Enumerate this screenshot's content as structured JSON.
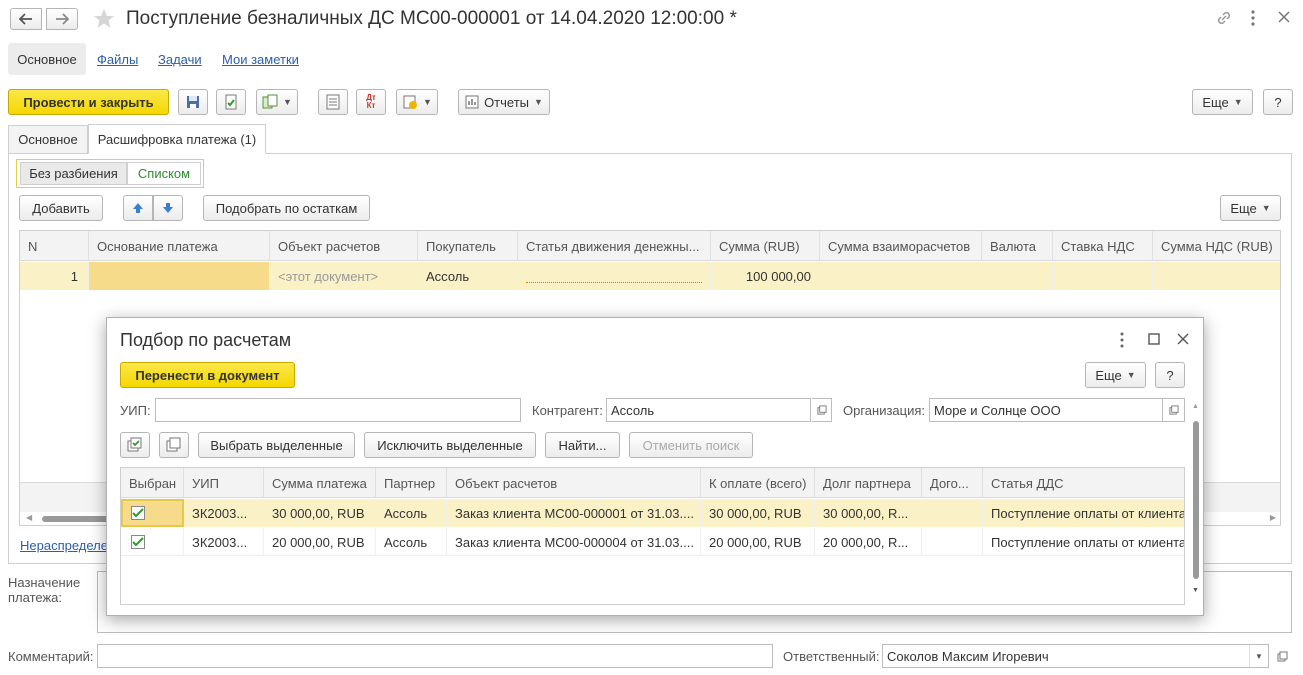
{
  "window": {
    "title": "Поступление безналичных ДС МС00-000001 от 14.04.2020 12:00:00 *"
  },
  "nav_tabs": [
    "Основное",
    "Файлы",
    "Задачи",
    "Мои заметки"
  ],
  "toolbar": {
    "post_close": "Провести и закрыть",
    "reports": "Отчеты",
    "more": "Еще",
    "help": "?"
  },
  "doc_tabs": [
    "Основное",
    "Расшифровка платежа (1)"
  ],
  "mode_switch": [
    "Без разбиения",
    "Списком"
  ],
  "list_toolbar": {
    "add": "Добавить",
    "pick": "Подобрать по остаткам",
    "more": "Еще"
  },
  "main_table": {
    "headers": [
      "N",
      "Основание платежа",
      "Объект расчетов",
      "Покупатель",
      "Статья движения денежны...",
      "Сумма (RUB)",
      "Сумма взаиморасчетов",
      "Валюта",
      "Ставка НДС",
      "Сумма НДС (RUB)"
    ],
    "rows": [
      {
        "n": "1",
        "basis": "",
        "object": "<этот документ>",
        "buyer": "Ассоль",
        "article": "",
        "sum": "100 000,00",
        "settle": "",
        "currency": "",
        "vat_rate": "",
        "vat_sum": ""
      }
    ]
  },
  "unallocated_link": "Нераспределе",
  "purpose_label": "Назначение платежа:",
  "comment_label": "Комментарий:",
  "responsible_label": "Ответственный:",
  "responsible_value": "Соколов Максим Игоревич",
  "dialog": {
    "title": "Подбор по расчетам",
    "transfer": "Перенести в документ",
    "more": "Еще",
    "help": "?",
    "uip_label": "УИП:",
    "uip_value": "",
    "counterparty_label": "Контрагент:",
    "counterparty_value": "Ассоль",
    "org_label": "Организация:",
    "org_value": "Море и Солнце ООО",
    "select_selected": "Выбрать выделенные",
    "exclude_selected": "Исключить выделенные",
    "find": "Найти...",
    "cancel_search": "Отменить поиск",
    "headers": [
      "Выбран",
      "УИП",
      "Сумма платежа",
      "Партнер",
      "Объект расчетов",
      "К оплате (всего)",
      "Долг партнера",
      "Дого...",
      "Статья ДДС"
    ],
    "rows": [
      {
        "checked": true,
        "uip": "ЗК2003...",
        "amount": "30 000,00, RUB",
        "partner": "Ассоль",
        "object": "Заказ клиента МС00-000001 от 31.03....",
        "to_pay": "30 000,00, RUB",
        "debt": "30 000,00, R...",
        "contract": "",
        "article": "Поступление оплаты от клиента"
      },
      {
        "checked": true,
        "uip": "ЗК2003...",
        "amount": "20 000,00, RUB",
        "partner": "Ассоль",
        "object": "Заказ клиента МС00-000004 от 31.03....",
        "to_pay": "20 000,00, RUB",
        "debt": "20 000,00, R...",
        "contract": "",
        "article": "Поступление оплаты от клиента"
      }
    ]
  }
}
